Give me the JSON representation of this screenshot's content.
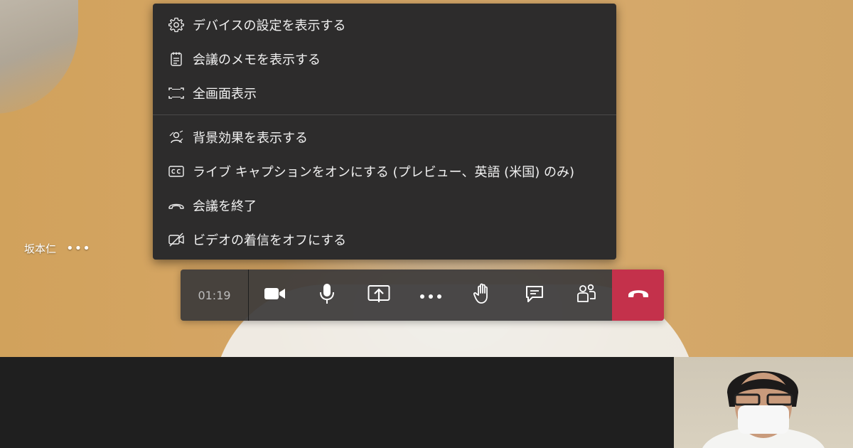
{
  "menu": {
    "items": [
      {
        "icon": "gear-icon",
        "label": "デバイスの設定を表示する"
      },
      {
        "icon": "notes-icon",
        "label": "会議のメモを表示する"
      },
      {
        "icon": "fullscreen-icon",
        "label": "全画面表示"
      },
      {
        "icon": "background-effects-icon",
        "label": "背景効果を表示する"
      },
      {
        "icon": "closed-captions-icon",
        "label": "ライブ キャプションをオンにする (プレビュー、英語 (米国) のみ)"
      },
      {
        "icon": "hang-up-icon",
        "label": "会議を終了"
      },
      {
        "icon": "video-off-icon",
        "label": "ビデオの着信をオフにする"
      }
    ]
  },
  "participant": {
    "name": "坂本仁",
    "more": "•••"
  },
  "toolbar": {
    "timer": "01:19",
    "buttons": [
      "camera-icon",
      "microphone-icon",
      "share-screen-icon",
      "more-options-icon",
      "raise-hand-icon",
      "chat-icon",
      "participants-icon",
      "hang-up-icon"
    ],
    "end_call_color": "#c4314b"
  }
}
